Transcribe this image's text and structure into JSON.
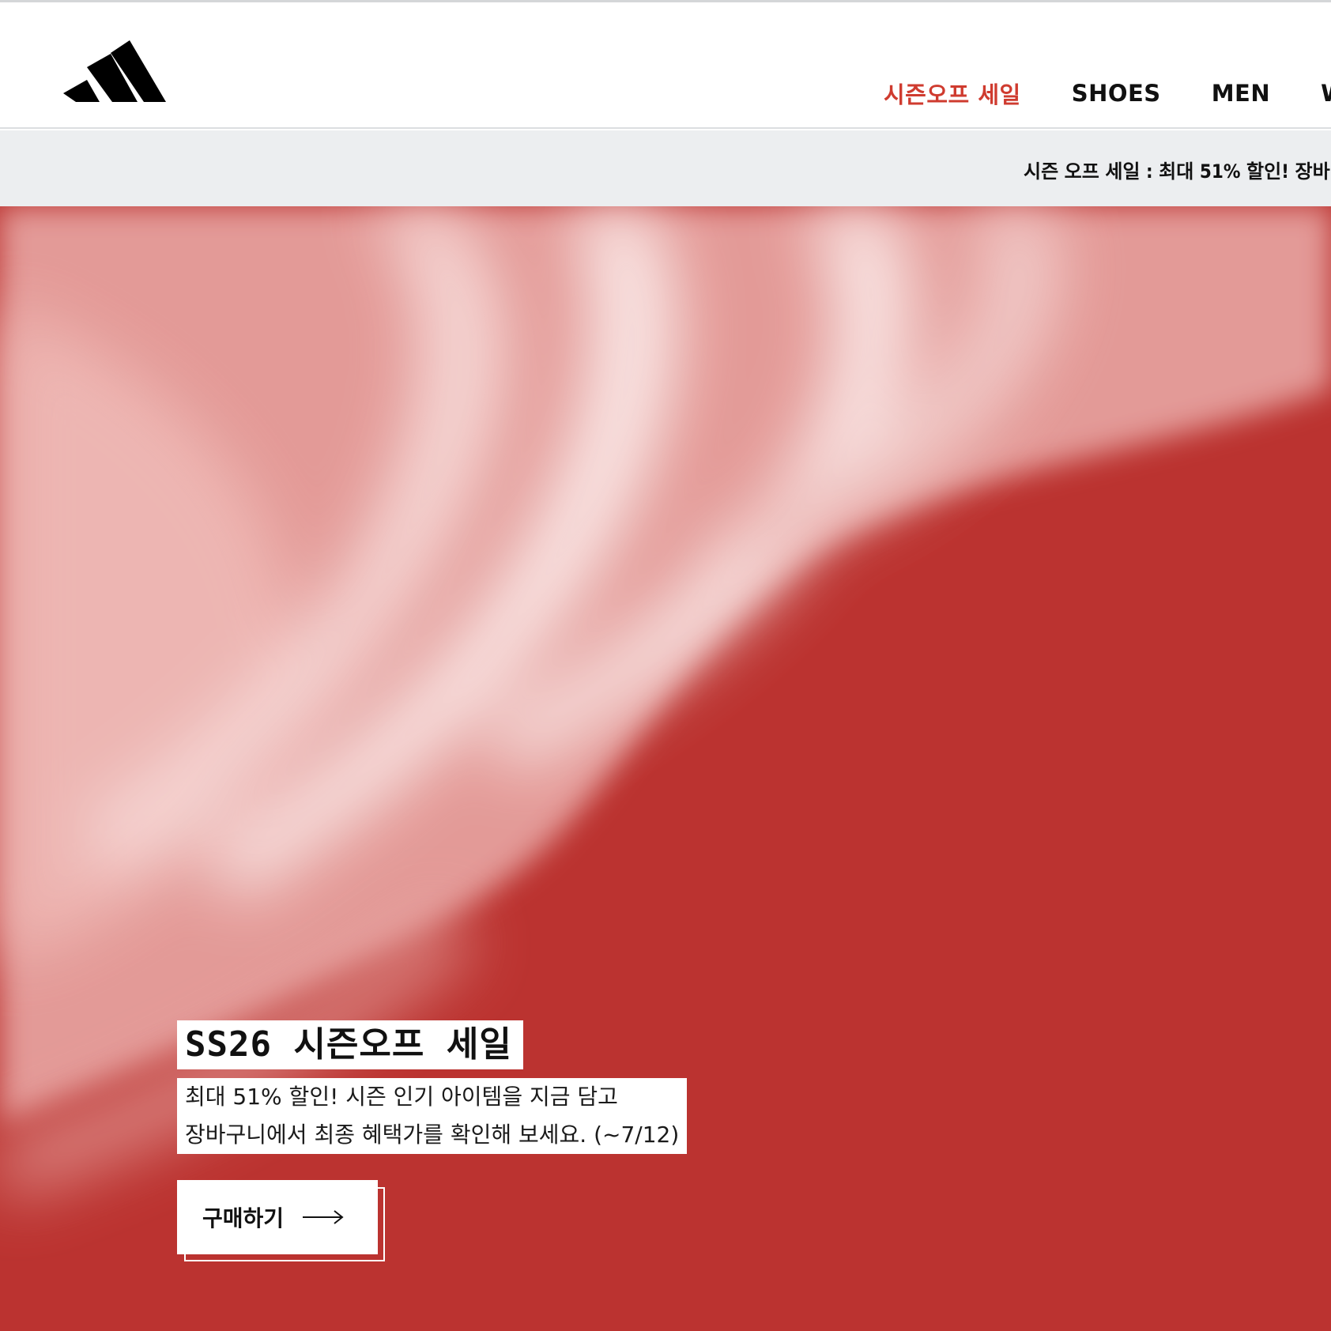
{
  "brand": {
    "logo_name": "adidas-logo",
    "logo_color": "#000000"
  },
  "nav": {
    "items": [
      {
        "label": "시즌오프 세일",
        "highlight": true,
        "color": "#cf3b2f"
      },
      {
        "label": "SHOES"
      },
      {
        "label": "MEN"
      },
      {
        "label": "WO"
      }
    ]
  },
  "promo_bar": {
    "text": "시즌 오프 세일 : 최대 51% 할인! 장바",
    "background": "#eceef0"
  },
  "hero": {
    "background": "#bb3330",
    "title": "SS26 시즌오프 세일",
    "subtitle_line1": "최대 51% 할인! 시즌 인기 아이템을 지금 담고",
    "subtitle_line2": "장바구니에서 최종 혜택가를 확인해 보세요. (~7/12)",
    "cta_label": "구매하기",
    "cta_icon": "arrow-right-icon"
  }
}
